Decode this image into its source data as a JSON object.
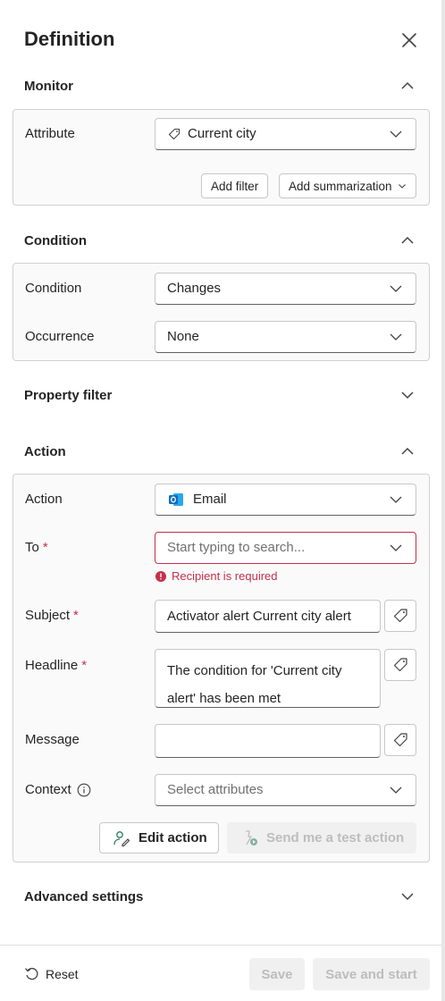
{
  "panel": {
    "title": "Definition"
  },
  "monitor": {
    "header": "Monitor",
    "attribute_label": "Attribute",
    "attribute_value": "Current city",
    "add_filter": "Add filter",
    "add_summarization": "Add summarization"
  },
  "condition": {
    "header": "Condition",
    "condition_label": "Condition",
    "condition_value": "Changes",
    "occurrence_label": "Occurrence",
    "occurrence_value": "None"
  },
  "property_filter": {
    "header": "Property filter"
  },
  "action": {
    "header": "Action",
    "action_label": "Action",
    "action_value": "Email",
    "to_label": "To",
    "to_placeholder": "Start typing to search...",
    "to_error": "Recipient is required",
    "subject_label": "Subject",
    "subject_value": "Activator alert Current city alert",
    "headline_label": "Headline",
    "headline_line1": "The condition for 'Current city",
    "headline_line2": "alert' has been met",
    "message_label": "Message",
    "message_value": "",
    "context_label": "Context",
    "context_placeholder": "Select attributes",
    "edit_action": "Edit action",
    "send_test": "Send me a test action",
    "required_marker": "*"
  },
  "advanced": {
    "header": "Advanced settings"
  },
  "footer": {
    "reset": "Reset",
    "save": "Save",
    "save_start": "Save and start"
  },
  "colors": {
    "error": "#c4314b",
    "outlook_blue": "#0f6cbd",
    "edit_icon_green": "#2e7d5b"
  }
}
